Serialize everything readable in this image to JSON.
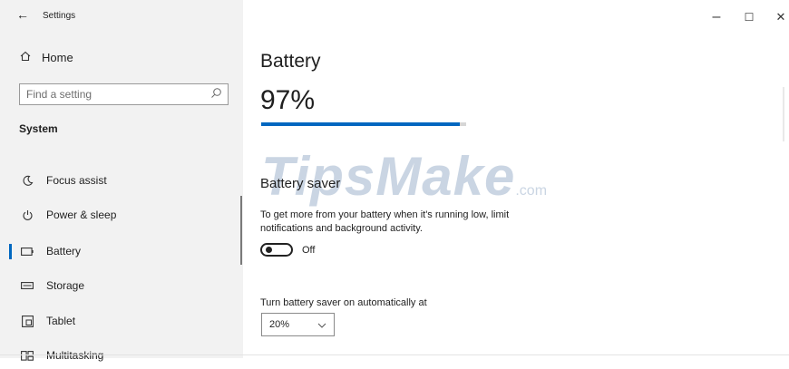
{
  "window": {
    "title": "Settings",
    "controls": {
      "minimize": "–",
      "maximize": "☐",
      "close": "✕"
    }
  },
  "sidebar": {
    "home_label": "Home",
    "search": {
      "placeholder": "Find a setting"
    },
    "section_title": "System",
    "items": [
      {
        "label": "Focus assist",
        "icon": "moon-icon",
        "selected": false
      },
      {
        "label": "Power & sleep",
        "icon": "power-icon",
        "selected": false
      },
      {
        "label": "Battery",
        "icon": "battery-icon",
        "selected": true
      },
      {
        "label": "Storage",
        "icon": "storage-icon",
        "selected": false
      },
      {
        "label": "Tablet",
        "icon": "tablet-icon",
        "selected": false
      },
      {
        "label": "Multitasking",
        "icon": "multitasking-icon",
        "selected": false
      }
    ]
  },
  "main": {
    "page_title": "Battery",
    "battery_percent_text": "97%",
    "battery_level": 0.97,
    "watermark": {
      "text": "TipsMake",
      "suffix": ".com"
    },
    "battery_saver": {
      "heading": "Battery saver",
      "description": "To get more from your battery when it's running low, limit notifications and background activity.",
      "toggle_state": "Off"
    },
    "auto_label": "Turn battery saver on automatically at",
    "auto_value": "20%"
  },
  "colors": {
    "accent": "#0067c0",
    "sidebar_bg": "#f2f2f2",
    "track": "#d6d6d6"
  }
}
